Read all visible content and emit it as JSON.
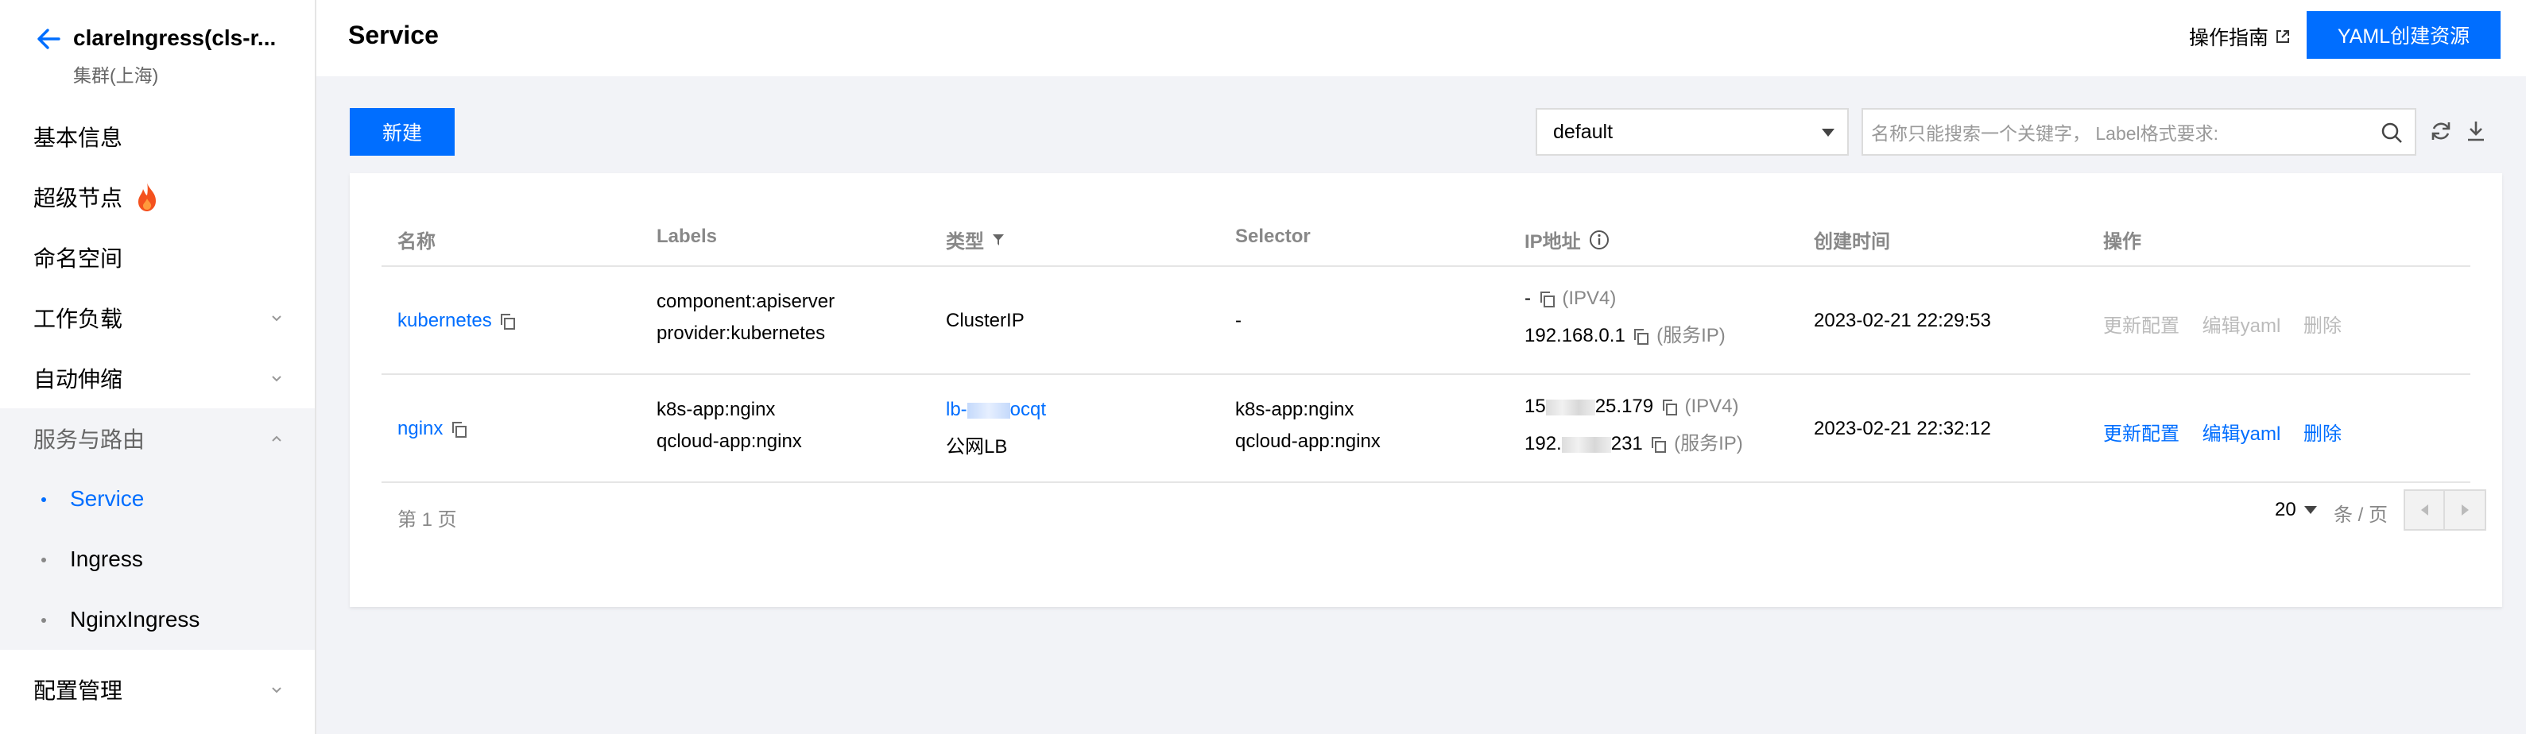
{
  "sidebar": {
    "cluster_name": "clareIngress(cls-r...",
    "cluster_region": "集群(上海)",
    "items": [
      {
        "label": "基本信息"
      },
      {
        "label": "超级节点"
      },
      {
        "label": "命名空间"
      },
      {
        "label": "工作负载"
      },
      {
        "label": "自动伸缩"
      },
      {
        "label": "服务与路由"
      },
      {
        "label": "配置管理"
      }
    ],
    "sub_items": [
      {
        "label": "Service"
      },
      {
        "label": "Ingress"
      },
      {
        "label": "NginxIngress"
      }
    ]
  },
  "header": {
    "title": "Service",
    "guide_label": "操作指南",
    "yaml_button": "YAML创建资源"
  },
  "toolbar": {
    "new_button": "新建",
    "namespace": "default",
    "search_placeholder": "名称只能搜索一个关键字， Label格式要求:"
  },
  "table": {
    "columns": [
      "名称",
      "Labels",
      "类型",
      "Selector",
      "IP地址",
      "创建时间",
      "操作"
    ],
    "rows": [
      {
        "name": "kubernetes",
        "labels": [
          "component:apiserver",
          "provider:kubernetes"
        ],
        "type": "ClusterIP",
        "selector": [
          "-"
        ],
        "ip1": "-",
        "ip1_tag": "(IPV4)",
        "ip2": "192.168.0.1",
        "ip2_tag": "(服务IP)",
        "created": "2023-02-21 22:29:53"
      },
      {
        "name": "nginx",
        "labels": [
          "k8s-app:nginx",
          "qcloud-app:nginx"
        ],
        "type_link_start": "lb-",
        "type_link_end": "ocqt",
        "type_sub": "公网LB",
        "selector": [
          "k8s-app:nginx",
          "qcloud-app:nginx"
        ],
        "ip1_start": "15",
        "ip1_end": "25.179",
        "ip1_tag": "(IPV4)",
        "ip2_start": "192.",
        "ip2_end": "231",
        "ip2_tag": "(服务IP)",
        "created": "2023-02-21 22:32:12"
      }
    ],
    "actions": {
      "update": "更新配置",
      "edit_yaml": "编辑yaml",
      "delete": "删除"
    }
  },
  "pagination": {
    "page_info": "第 1 页",
    "page_size": "20",
    "per_page_label": "条 / 页"
  },
  "colors": {
    "accent": "#006eff",
    "fire": "#f4511e"
  },
  "icons": [
    "back-arrow-icon",
    "fire-icon",
    "chevron-down-icon",
    "chevron-up-icon",
    "external-link-icon",
    "search-icon",
    "refresh-icon",
    "download-icon",
    "filter-icon",
    "info-icon",
    "copy-icon"
  ]
}
